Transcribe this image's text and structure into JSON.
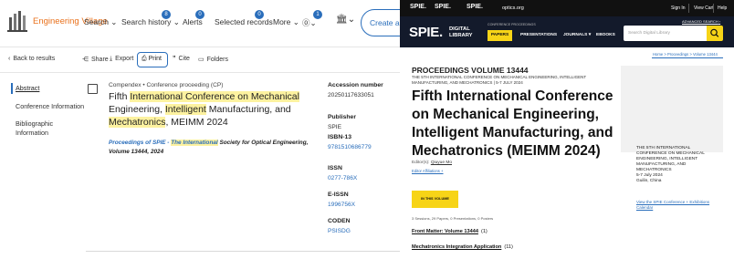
{
  "engineering_village": {
    "brand": "Engineering Village",
    "nav": {
      "search": "Search",
      "search_history": "Search history",
      "search_history_badge": "8",
      "alerts": "Alerts",
      "alerts_badge": "0",
      "selected_records": "Selected records",
      "selected_records_badge": "0",
      "more": "More",
      "help_badge": "1",
      "create_account": "Create acc"
    },
    "toolbar": {
      "back": "Back to results",
      "share": "Share",
      "export": "Export",
      "print": "Print",
      "cite": "Cite",
      "folders": "Folders"
    },
    "sidebar": {
      "items": [
        "Abstract",
        "Conference Information",
        "Bibliographic Information"
      ]
    },
    "record": {
      "database": "Compendex",
      "doc_type": "Conference proceeding (CP)",
      "title_parts": [
        {
          "text": "Fifth ",
          "hl": false
        },
        {
          "text": "International Conference on Mechanical",
          "hl": true
        },
        {
          "text": " Engineering, ",
          "hl": false
        },
        {
          "text": "Intelligent",
          "hl": true
        },
        {
          "text": " Manufacturing, and ",
          "hl": false
        },
        {
          "text": "Mechatronics",
          "hl": true
        },
        {
          "text": ", MEIMM 2024",
          "hl": false
        }
      ],
      "pub_prefix": "Proceedings of SPIE - ",
      "pub_hl": "The International",
      "pub_rest": " Society for Optical Engineering, Volume 13444, 2024"
    },
    "details": [
      {
        "label": "Accession number",
        "value": "20250117633051",
        "link": false
      },
      {
        "label": "Publisher",
        "value": "SPIE",
        "link": false
      },
      {
        "label": "ISBN-13",
        "value": "9781510686779",
        "link": true
      },
      {
        "label": "ISSN",
        "value": "0277-786X",
        "link": true
      },
      {
        "label": "E-ISSN",
        "value": "1996756X",
        "link": true
      },
      {
        "label": "CODEN",
        "value": "PSISDG",
        "link": true
      }
    ]
  },
  "spie": {
    "topbar": {
      "links": [
        "SPIE.",
        "SPIE.",
        "SPIE.",
        "optics.org"
      ],
      "account": [
        "Sign In",
        "View Cart",
        "Help"
      ]
    },
    "logo": "SPIE.",
    "logo_sub_1": "DIGITAL",
    "logo_sub_2": "LIBRARY",
    "conference_proceedings": "CONFERENCE PROCEEDINGS",
    "nav": [
      "PAPERS",
      "PRESENTATIONS",
      "JOURNALS",
      "EBOOKS"
    ],
    "search_placeholder": "Search Digital Library",
    "advanced_search": "ADVANCED SEARCH",
    "breadcrumb": "Home > Proceedings > Volume 13444",
    "volume": "PROCEEDINGS VOLUME 13444",
    "subtitle": "THE 5TH INTERNATIONAL CONFERENCE ON MECHANICAL ENGINEERING, INTELLIGENT MANUFACTURING, AND MECHATRONICS | 5-7 JULY 2024",
    "title": "Fifth International Conference on Mechanical Engineering, Intelligent Manufacturing, and Mechatronics (MEIMM 2024)",
    "editors_label": "Editor(s):",
    "editor_name": "Qiuyue Mo",
    "editor_affiliations": "Editor Affiliations +",
    "in_this_volume": "IN THIS VOLUME",
    "counts": "3 Sessions, 29 Papers, 0 Presentations, 0 Posters",
    "sections": [
      {
        "name": "Front Matter: Volume 13444",
        "count": "(1)"
      },
      {
        "name": "Mechatronics Integration Application",
        "count": "(11)"
      }
    ],
    "sidebar_box": {
      "lines": [
        "THE 5TH INTERNATIONAL",
        "CONFERENCE ON MECHANICAL",
        "ENGINEERING, INTELLIGENT",
        "MANUFACTURING, AND",
        "MECHATRONICS",
        "5-7 July 2024",
        "Guilin, China"
      ],
      "link": "View the SPIE Conference + Exhibitions Calendar"
    }
  }
}
